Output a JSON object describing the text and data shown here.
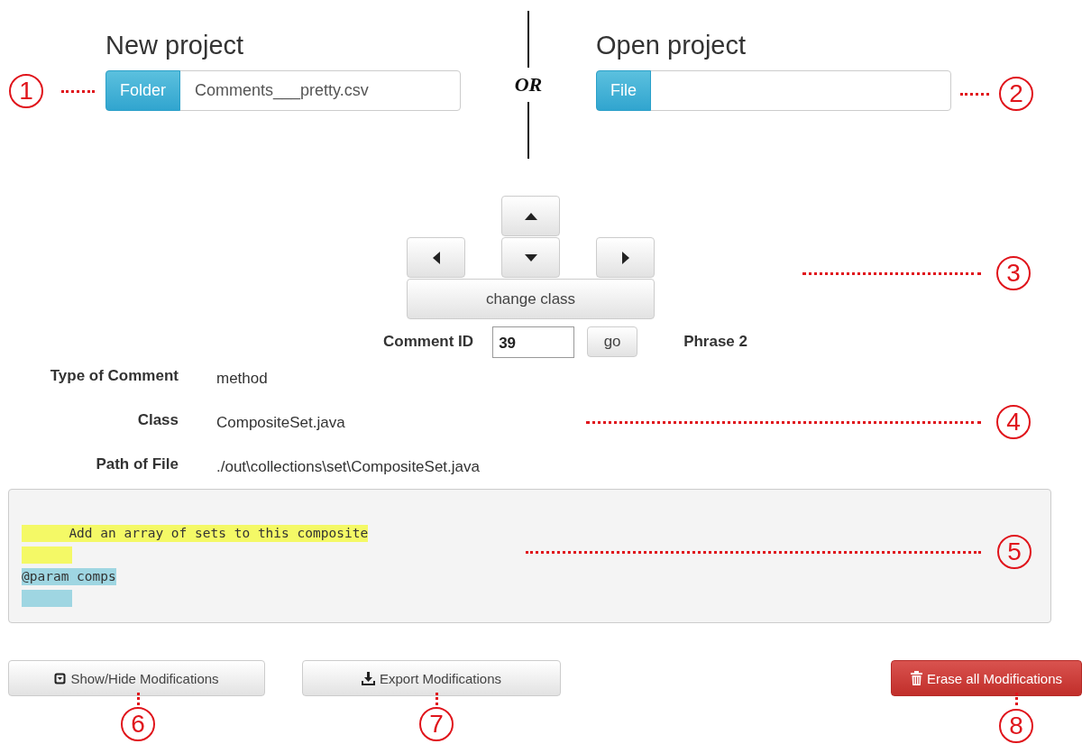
{
  "new_project": {
    "title": "New project",
    "button": "Folder",
    "value": "Comments___pretty.csv"
  },
  "separator": {
    "label": "OR"
  },
  "open_project": {
    "title": "Open project",
    "button": "File"
  },
  "navigation": {
    "change_button": "change class"
  },
  "comment_id": {
    "label": "Comment ID",
    "value": "39",
    "go_button": "go",
    "phrase": "Phrase 2"
  },
  "details": [
    {
      "label": "Type of Comment",
      "value": "method"
    },
    {
      "label": "Class",
      "value": "CompositeSet.java"
    },
    {
      "label": "Path of File",
      "value": "./out\\collections\\set\\CompositeSet.java"
    }
  ],
  "code_lines": [
    {
      "kind": "text",
      "text": "      Add an array of sets to this composite",
      "color": "#f4f966"
    },
    {
      "kind": "blank",
      "color": "#f4f966"
    },
    {
      "kind": "text",
      "text": "@param comps",
      "color": "#9fd6e2"
    },
    {
      "kind": "blank",
      "color": "#9fd6e2"
    }
  ],
  "buttons": [
    {
      "kind": "toggle",
      "label": "Show/Hide Modifications"
    },
    {
      "kind": "export",
      "label": "Export Modifications"
    },
    {
      "kind": "erase",
      "label": "Erase all Modifications"
    }
  ],
  "callouts": [
    {
      "number": "1"
    },
    {
      "number": "2"
    },
    {
      "number": "3"
    },
    {
      "number": "4"
    },
    {
      "number": "5"
    },
    {
      "number": "6"
    },
    {
      "number": "7"
    },
    {
      "number": "8"
    }
  ]
}
